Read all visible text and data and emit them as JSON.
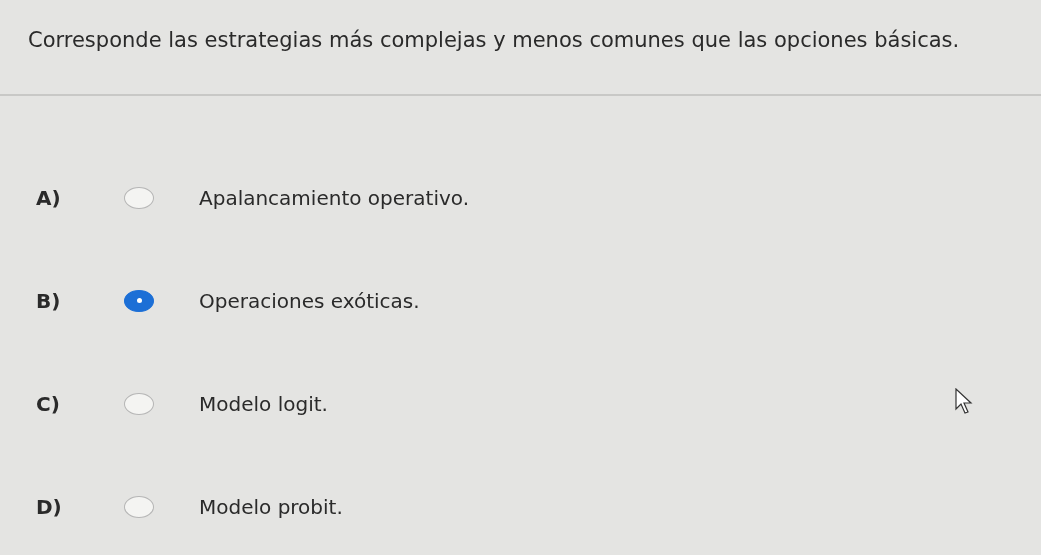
{
  "question": "Corresponde las estrategias más complejas y menos comunes que las opciones básicas.",
  "options": [
    {
      "letter": "A)",
      "label": "Apalancamiento operativo.",
      "selected": false
    },
    {
      "letter": "B)",
      "label": "Operaciones exóticas.",
      "selected": true
    },
    {
      "letter": "C)",
      "label": "Modelo logit.",
      "selected": false
    },
    {
      "letter": "D)",
      "label": "Modelo probit.",
      "selected": false
    }
  ]
}
